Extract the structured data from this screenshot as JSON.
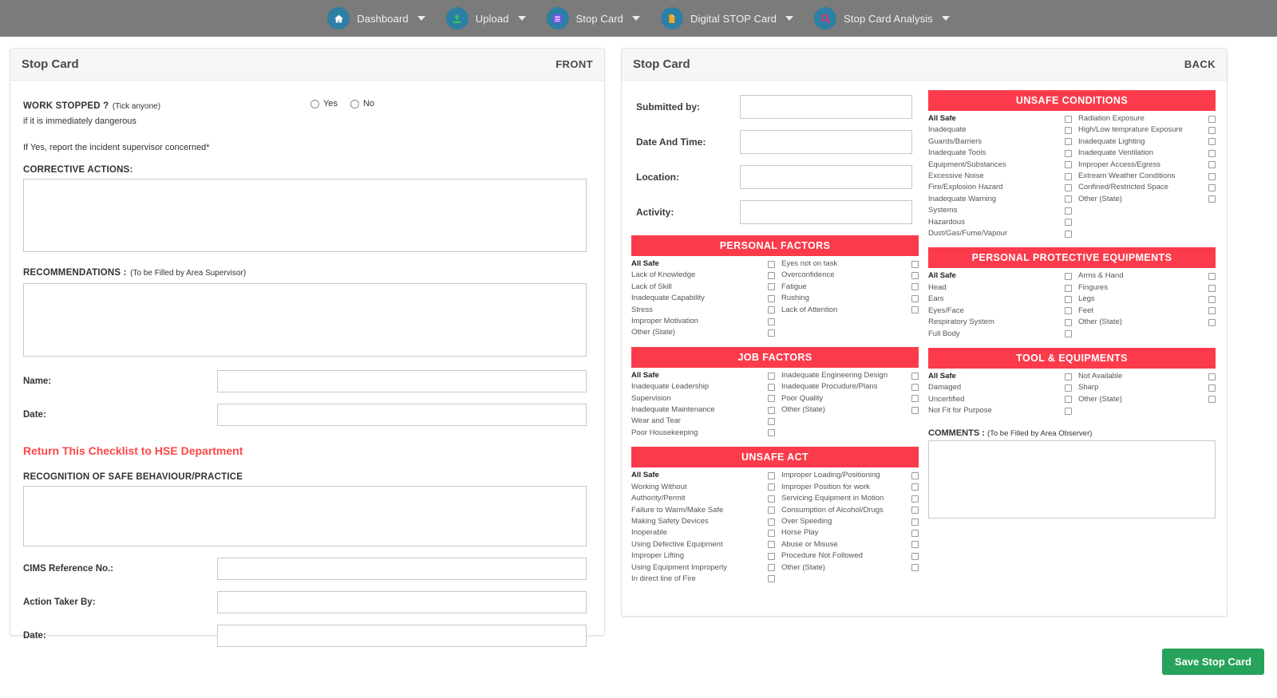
{
  "nav": {
    "items": [
      {
        "label": "Dashboard",
        "icon": "home-icon",
        "icon_color": "#ffffff",
        "badge_color": "#2d7fa5",
        "caret": true
      },
      {
        "label": "Upload",
        "icon": "upload-icon",
        "icon_color": "#2ecc56",
        "badge_color": "#2d7fa5",
        "caret": true
      },
      {
        "label": "Stop Card",
        "icon": "list-icon",
        "icon_color": "#8a3ffc",
        "badge_color": "#2d7fa5",
        "caret": true
      },
      {
        "label": "Digital STOP Card",
        "icon": "document-icon",
        "icon_color": "#f5a623",
        "badge_color": "#2d7fa5",
        "caret": true
      },
      {
        "label": "Stop Card Analysis",
        "icon": "search-icon",
        "icon_color": "#ef2b5b",
        "badge_color": "#2d7fa5",
        "caret": true
      }
    ]
  },
  "front": {
    "title": "Stop Card",
    "side": "FRONT",
    "work_stopped_label": "WORK STOPPED ?",
    "work_stopped_hint": "(Tick anyone)",
    "work_stopped_sub": "if it is immediately dangerous",
    "radio_yes": "Yes",
    "radio_no": "No",
    "if_yes_note": "If Yes, report the incident supervisor concerned*",
    "corrective_label": "CORRECTIVE ACTIONS:",
    "corrective_value": "",
    "recommendations_label": "RECOMMENDATIONS :",
    "recommendations_hint": "(To be Filled by Area Supervisor)",
    "recommendations_value": "",
    "name_label": "Name:",
    "name_value": "",
    "date_label": "Date:",
    "date_value": "",
    "return_note": "Return This Checklist to HSE Department",
    "recognition_label": "RECOGNITION OF SAFE BEHAVIOUR/PRACTICE",
    "recognition_value": "",
    "cims_label": "CIMS Reference No.:",
    "cims_value": "",
    "action_taker_label": "Action Taker By:",
    "action_taker_value": "",
    "date2_label": "Date:",
    "date2_value": ""
  },
  "back": {
    "title": "Stop Card",
    "side": "BACK",
    "meta": [
      {
        "label": "Submitted by:",
        "value": ""
      },
      {
        "label": "Date And Time:",
        "value": ""
      },
      {
        "label": "Location:",
        "value": ""
      },
      {
        "label": "Activity:",
        "value": ""
      }
    ],
    "comments_label": "COMMENTS :",
    "comments_hint": "(To be Filled by Area Observer)",
    "comments_value": "",
    "sections": {
      "unsafe_conditions": {
        "title": "UNSAFE CONDITIONS",
        "left": [
          "All Safe",
          "Inadequate",
          "Guards/Barriers",
          "Inadequate Tools",
          "Equipment/Substances",
          "Excessive Noise",
          "Fire/Explosion Hazard",
          "Inadequate Warning",
          "Systems",
          "Hazardous",
          "Dust/Gas/Fume/Vapour"
        ],
        "right": [
          "Radiation Exposure",
          "High/Low temprature Exposure",
          "Inadequate Lighting",
          "Inadequate Ventilation",
          "Improper Access/Egress",
          "Extream Weather Conditions",
          "Confined/Restricted Space",
          "Other (State)"
        ]
      },
      "personal_factors": {
        "title": "PERSONAL FACTORS",
        "left": [
          "All Safe",
          "Lack of Knowledge",
          "Lack of Skill",
          "Inadequate Capability",
          "Stress",
          "Improper Motivation",
          "Other (State)"
        ],
        "right": [
          "Eyes not on task",
          "Overconfidence",
          "Fatigue",
          "Rushing",
          "Lack of Attention"
        ]
      },
      "ppe": {
        "title": "PERSONAL PROTECTIVE EQUIPMENTS",
        "left": [
          "All Safe",
          "Head",
          "Ears",
          "Eyes/Face",
          "Respiratory System",
          "Full Body"
        ],
        "right": [
          "Arms & Hand",
          "Fingures",
          "Legs",
          "Feet",
          "Other (State)"
        ]
      },
      "job_factors": {
        "title": "JOB FACTORS",
        "left": [
          "All Safe",
          "Inadequate Leadership",
          "Supervision",
          "Inadequate Maintenance",
          "Wear and Tear",
          "Poor Housekeeping"
        ],
        "right": [
          "Inadequate Engineering Design",
          "Inadequate Procudure/Plans",
          "Poor Quality",
          "Other (State)"
        ]
      },
      "tool_equipments": {
        "title": "TOOL & EQUIPMENTS",
        "left": [
          "All Safe",
          "Damaged",
          "Uncertified",
          "Not Fit for Purpose"
        ],
        "right": [
          "Not Available",
          "Sharp",
          "Other (State)"
        ]
      },
      "unsafe_act": {
        "title": "UNSAFE ACT",
        "left": [
          "All Safe",
          "Working Without",
          "Authority/Permit",
          "Failure to Warm/Make Safe",
          "Making Safety Devices",
          "Inoperable",
          "Using Defective Equipment",
          "Improper Lifting",
          "Using Equipment Improperly",
          "In direct line of Fire"
        ],
        "right": [
          "Improper Loading/Positioning",
          "Improper Position for work",
          "Servicing Equipment in Motion",
          "Consumption of Alcohol/Drugs",
          "Over Speeding",
          "Horse Play",
          "Abuse or Misuse",
          "Procedure Not Followed",
          "Other (State)"
        ]
      }
    }
  },
  "save_button": {
    "label": "Save Stop Card",
    "color": "#27a35b"
  }
}
